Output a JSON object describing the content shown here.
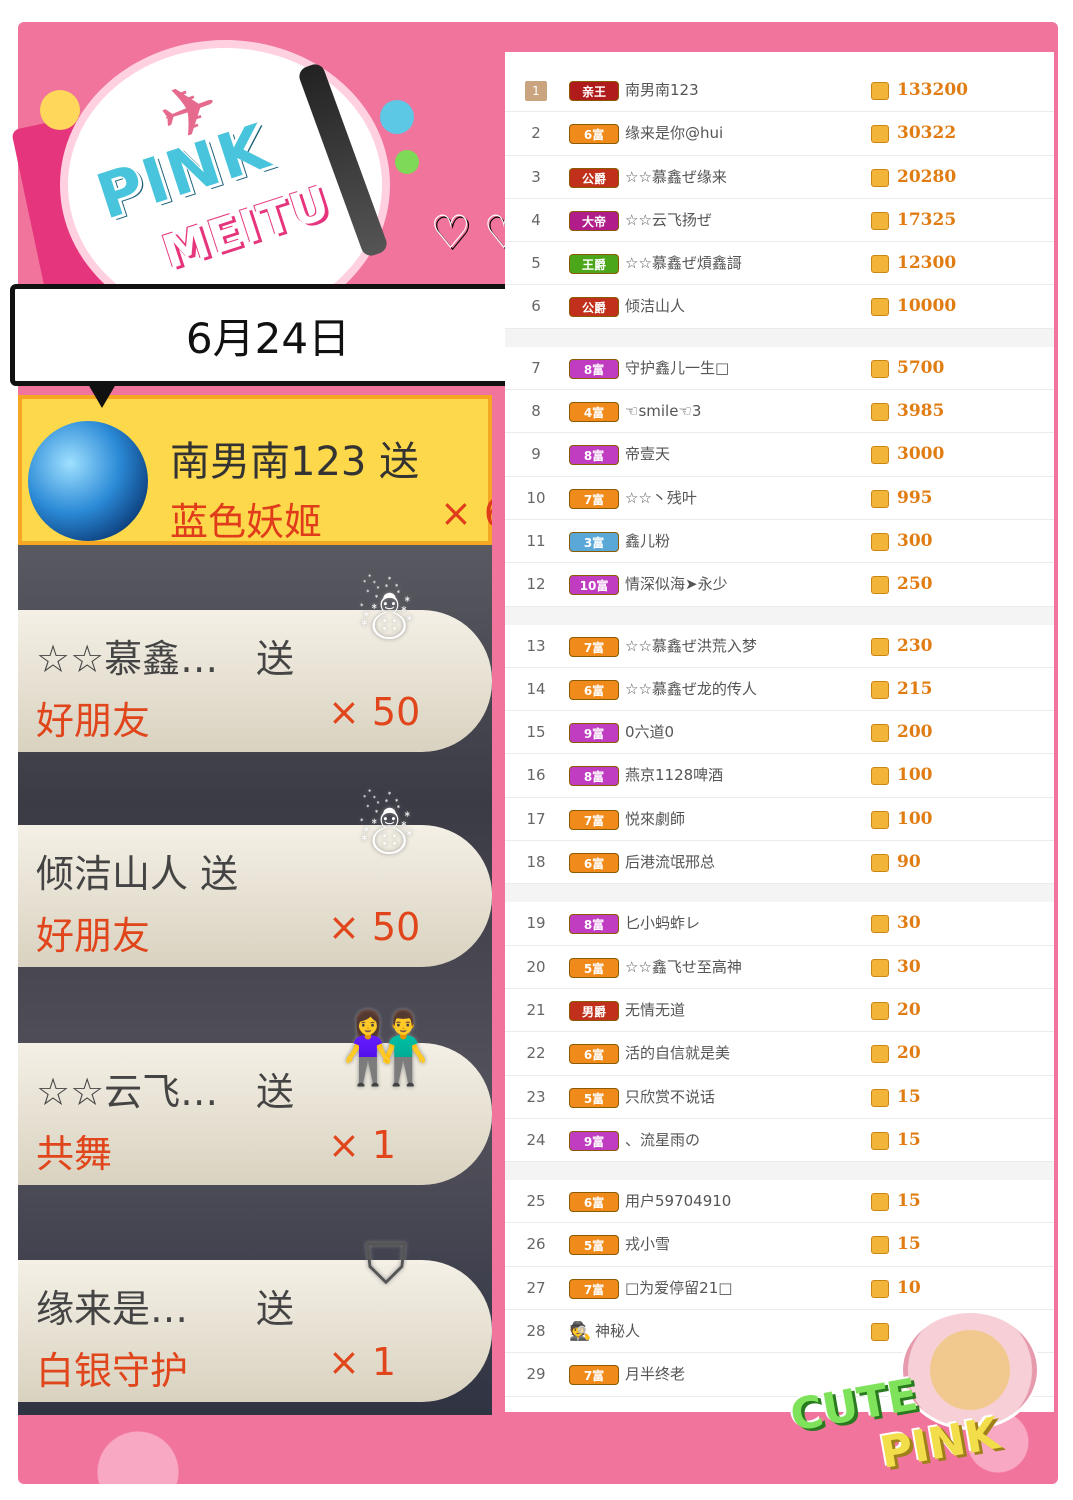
{
  "date_label": "6月24日",
  "decor": {
    "badge_line1": "PINK",
    "badge_line2": "MEITU",
    "corner_line1": "CUTE",
    "corner_line2": "PINK"
  },
  "gifts": [
    {
      "sender": "南男南123 送",
      "gift": "蓝色妖姬",
      "qty": "× 6"
    },
    {
      "sender": "☆☆慕鑫…",
      "send": "送",
      "gift": "好朋友",
      "qty": "× 50",
      "icon": "teru-teru-bozu-icon"
    },
    {
      "sender": "倾洁山人 送",
      "send": "",
      "gift": "好朋友",
      "qty": "× 50",
      "icon": "teru-teru-bozu-icon"
    },
    {
      "sender": "☆☆云飞…",
      "send": "送",
      "gift": "共舞",
      "qty": "× 1",
      "icon": "dancing-couple-icon"
    },
    {
      "sender": "缘来是…",
      "send": "送",
      "gift": "白银守护",
      "qty": "× 1",
      "icon": "silver-guard-shield-icon"
    }
  ],
  "ranking": [
    [
      {
        "rank": "1",
        "level": "亲王",
        "level_color": "#b01c1c",
        "name": "南男南123",
        "score": "133200"
      },
      {
        "rank": "2",
        "level": "6富",
        "level_color": "#f08a1a",
        "name": "缘来是你@hui",
        "score": "30322"
      },
      {
        "rank": "3",
        "level": "公爵",
        "level_color": "#c0301a",
        "name": "☆☆慕鑫ぜ缘来",
        "score": "20280"
      },
      {
        "rank": "4",
        "level": "大帝",
        "level_color": "#b01c8a",
        "name": "☆☆云飞扬ぜ",
        "score": "17325"
      },
      {
        "rank": "5",
        "level": "王爵",
        "level_color": "#4ca61a",
        "name": "☆☆慕鑫ぜ熕鑫謌",
        "score": "12300"
      },
      {
        "rank": "6",
        "level": "公爵",
        "level_color": "#c0301a",
        "name": "倾洁山人",
        "score": "10000"
      }
    ],
    [
      {
        "rank": "7",
        "level": "8富",
        "level_color": "#c03cc0",
        "name": "守护鑫儿一生□",
        "score": "5700"
      },
      {
        "rank": "8",
        "level": "4富",
        "level_color": "#f08a1a",
        "name": "☜smile☜3",
        "score": "3985"
      },
      {
        "rank": "9",
        "level": "8富",
        "level_color": "#c03cc0",
        "name": "帝壹天",
        "score": "3000"
      },
      {
        "rank": "10",
        "level": "7富",
        "level_color": "#f08a1a",
        "name": "☆☆丶残叶",
        "score": "995"
      },
      {
        "rank": "11",
        "level": "3富",
        "level_color": "#5aa8d8",
        "name": "鑫儿粉",
        "score": "300"
      },
      {
        "rank": "12",
        "level": "10富",
        "level_color": "#c03cc0",
        "name": "情深似海➤永少",
        "score": "250"
      }
    ],
    [
      {
        "rank": "13",
        "level": "7富",
        "level_color": "#f08a1a",
        "name": "☆☆慕鑫ぜ洪荒入梦",
        "score": "230"
      },
      {
        "rank": "14",
        "level": "6富",
        "level_color": "#f08a1a",
        "name": "☆☆慕鑫ぜ龙的传人",
        "score": "215"
      },
      {
        "rank": "15",
        "level": "9富",
        "level_color": "#c03cc0",
        "name": "0六道0",
        "score": "200"
      },
      {
        "rank": "16",
        "level": "8富",
        "level_color": "#c03cc0",
        "name": "燕京1128啤酒",
        "score": "100"
      },
      {
        "rank": "17",
        "level": "7富",
        "level_color": "#f08a1a",
        "name": "悦來劇師",
        "score": "100"
      },
      {
        "rank": "18",
        "level": "6富",
        "level_color": "#f08a1a",
        "name": "后港流氓邢总",
        "score": "90"
      }
    ],
    [
      {
        "rank": "19",
        "level": "8富",
        "level_color": "#c03cc0",
        "name": "匕小蚂蚱レ",
        "score": "30"
      },
      {
        "rank": "20",
        "level": "5富",
        "level_color": "#f08a1a",
        "name": "☆☆鑫飞せ至高神",
        "score": "30"
      },
      {
        "rank": "21",
        "level": "男爵",
        "level_color": "#c0301a",
        "name": "无情无道",
        "score": "20"
      },
      {
        "rank": "22",
        "level": "6富",
        "level_color": "#f08a1a",
        "name": "活的自信就是美",
        "score": "20"
      },
      {
        "rank": "23",
        "level": "5富",
        "level_color": "#f08a1a",
        "name": "只欣赏不说话",
        "score": "15"
      },
      {
        "rank": "24",
        "level": "9富",
        "level_color": "#c03cc0",
        "name": "、流星雨の",
        "score": "15"
      }
    ],
    [
      {
        "rank": "25",
        "level": "6富",
        "level_color": "#f08a1a",
        "name": "用户59704910",
        "score": "15"
      },
      {
        "rank": "26",
        "level": "5富",
        "level_color": "#f08a1a",
        "name": "戎小雪",
        "score": "15"
      },
      {
        "rank": "27",
        "level": "7富",
        "level_color": "#f08a1a",
        "name": "□为爱停留21□",
        "score": "10"
      },
      {
        "rank": "28",
        "level": "",
        "level_color": "",
        "name": "神秘人",
        "score": "",
        "mystery": true
      },
      {
        "rank": "29",
        "level": "7富",
        "level_color": "#f08a1a",
        "name": "月半终老",
        "score": ""
      }
    ]
  ]
}
